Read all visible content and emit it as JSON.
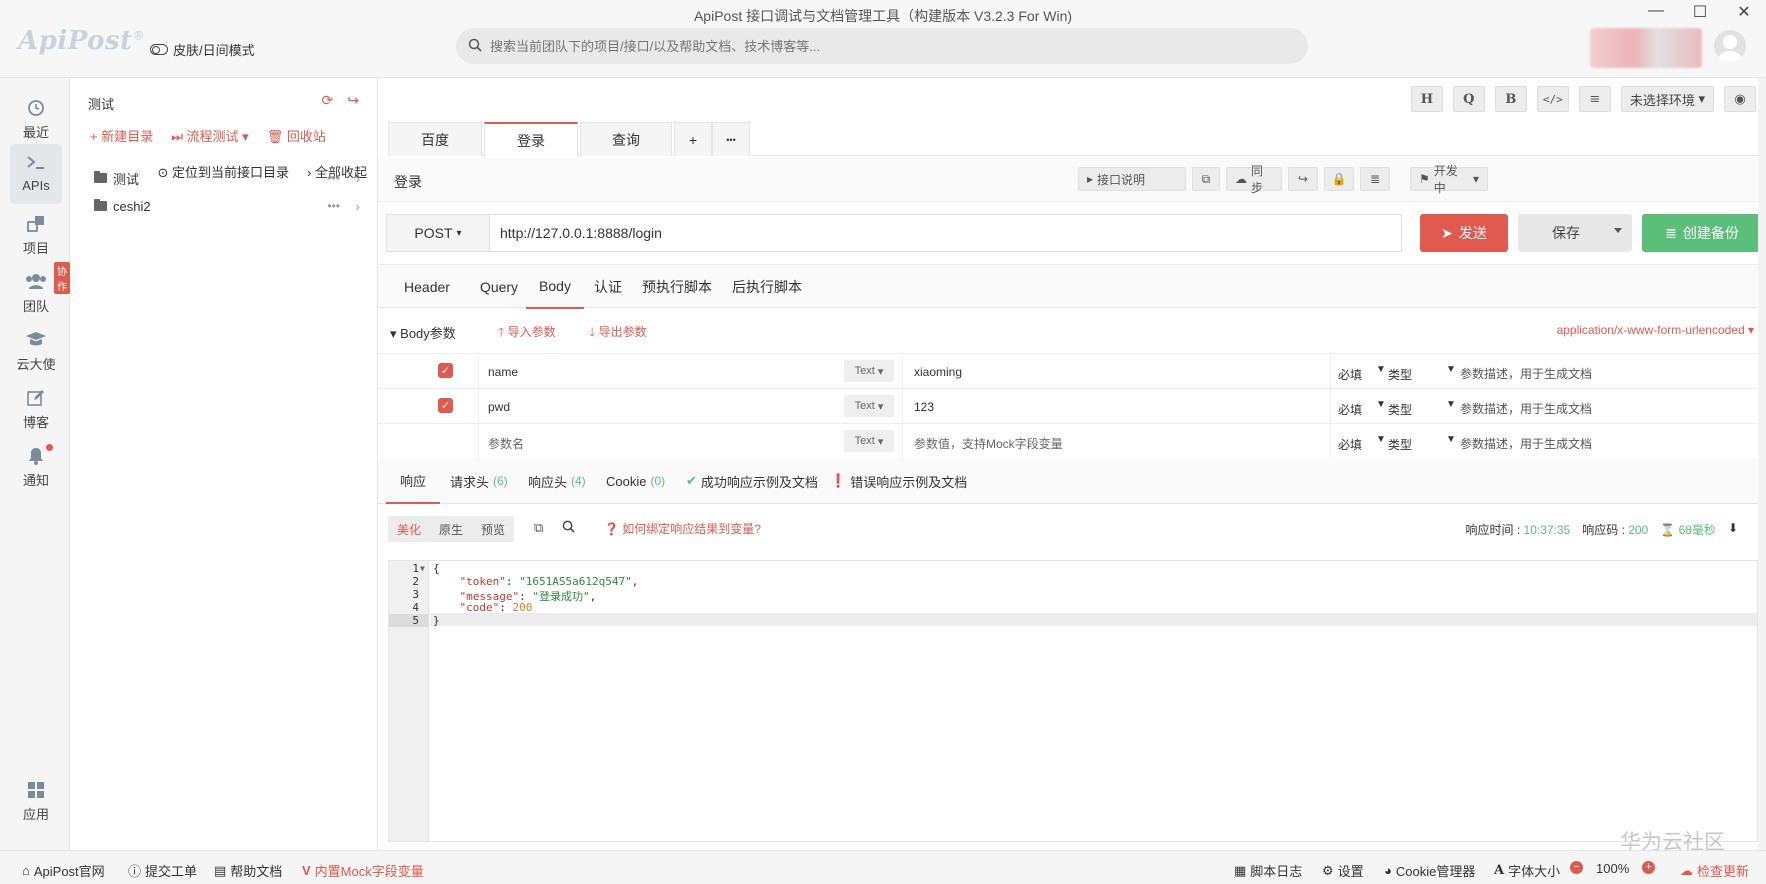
{
  "window": {
    "title": "ApiPost 接口调试与文档管理工具（构建版本 V3.2.3 For Win)",
    "minimize_icon": "minimize-icon",
    "maximize_icon": "maximize-icon",
    "close_icon": "close-icon"
  },
  "header": {
    "logo_text": "ApiPost",
    "logo_mark": "®",
    "skin_toggle_label": "皮肤/日间模式",
    "search_placeholder": "搜索当前团队下的项目/接口/以及帮助文档、技术博客等..."
  },
  "leftnav": {
    "items": [
      {
        "label": "最近",
        "icon": "clock-icon"
      },
      {
        "label": "APIs",
        "icon": "terminal-icon"
      },
      {
        "label": "项目",
        "icon": "project-icon"
      },
      {
        "label": "团队",
        "icon": "team-icon",
        "badge": "协作"
      },
      {
        "label": "云大使",
        "icon": "graduation-cap-icon"
      },
      {
        "label": "博客",
        "icon": "edit-icon"
      },
      {
        "label": "通知",
        "icon": "bell-icon"
      },
      {
        "label": "应用",
        "icon": "apps-grid-icon"
      }
    ]
  },
  "tree": {
    "title": "测试",
    "actions": {
      "new_dir": "新建目录",
      "flow_test": "流程测试",
      "recycle": "回收站"
    },
    "locate": "定位到当前接口目录",
    "collapse_all": "全部收起",
    "folders": [
      "测试",
      "ceshi2"
    ]
  },
  "toolbar": {
    "icons": [
      "H",
      "Q",
      "B"
    ],
    "env_select": "未选择环境"
  },
  "tabs": {
    "items": [
      "百度",
      "登录",
      "查询"
    ],
    "active": "登录",
    "add_label": "+",
    "more_label": "•••"
  },
  "request": {
    "name": "登录",
    "doc_button": "接口说明",
    "sync_button": "同步",
    "status_select": "开发中",
    "method": "POST",
    "url": "http://127.0.0.1:8888/login",
    "send_label": "发送",
    "save_label": "保存",
    "backup_label": "创建备份"
  },
  "subtabs": {
    "items": [
      "Header",
      "Query",
      "Body",
      "认证",
      "预执行脚本",
      "后执行脚本"
    ],
    "active": "Body"
  },
  "body": {
    "label": "Body参数",
    "import_label": "导入参数",
    "export_label": "导出参数",
    "content_type": "application/x-www-form-urlencoded",
    "rows": [
      {
        "checked": true,
        "key": "name",
        "type": "Text",
        "value": "xiaoming",
        "required": "必填",
        "field_type": "类型",
        "desc": "参数描述，用于生成文档"
      },
      {
        "checked": true,
        "key": "pwd",
        "type": "Text",
        "value": "123",
        "required": "必填",
        "field_type": "类型",
        "desc": "参数描述，用于生成文档"
      },
      {
        "checked": false,
        "key": "参数名",
        "type": "Text",
        "value": "参数值，支持Mock字段变量",
        "required": "必填",
        "field_type": "类型",
        "desc": "参数描述，用于生成文档"
      }
    ]
  },
  "response": {
    "tabs": [
      {
        "label": "响应",
        "count": ""
      },
      {
        "label": "请求头",
        "count": "(6)"
      },
      {
        "label": "响应头",
        "count": "(4)"
      },
      {
        "label": "Cookie",
        "count": "(0)"
      },
      {
        "label": "成功响应示例及文档",
        "count": ""
      },
      {
        "label": "错误响应示例及文档",
        "count": ""
      }
    ],
    "view_modes": [
      "美化",
      "原生",
      "预览"
    ],
    "bind_help": "如何绑定响应结果到变量?",
    "time_label": "响应时间 :",
    "time_value": "10:37:35",
    "code_label": "响应码 :",
    "code_value": "200",
    "duration": "68毫秒",
    "json_lines": [
      {
        "n": "1",
        "text": "{"
      },
      {
        "n": "2",
        "key": "\"token\"",
        "sep": ": ",
        "val": "\"1651AS5a612q547\"",
        "tail": ","
      },
      {
        "n": "3",
        "key": "\"message\"",
        "sep": ": ",
        "val": "\"登录成功\"",
        "tail": ","
      },
      {
        "n": "4",
        "key": "\"code\"",
        "sep": ": ",
        "num": "200",
        "tail": ""
      },
      {
        "n": "5",
        "text": "}"
      }
    ]
  },
  "watermark": "华为云社区",
  "statusbar": {
    "official": "ApiPost官网",
    "ticket": "提交工单",
    "help": "帮助文档",
    "mock": "内置Mock字段变量",
    "script_log": "脚本日志",
    "settings": "设置",
    "cookie_mgr": "Cookie管理器",
    "font_size": "字体大小",
    "zoom": "100%",
    "update": "检查更新"
  },
  "colors": {
    "accent": "#e05a4f",
    "success": "#5bbf7a"
  }
}
